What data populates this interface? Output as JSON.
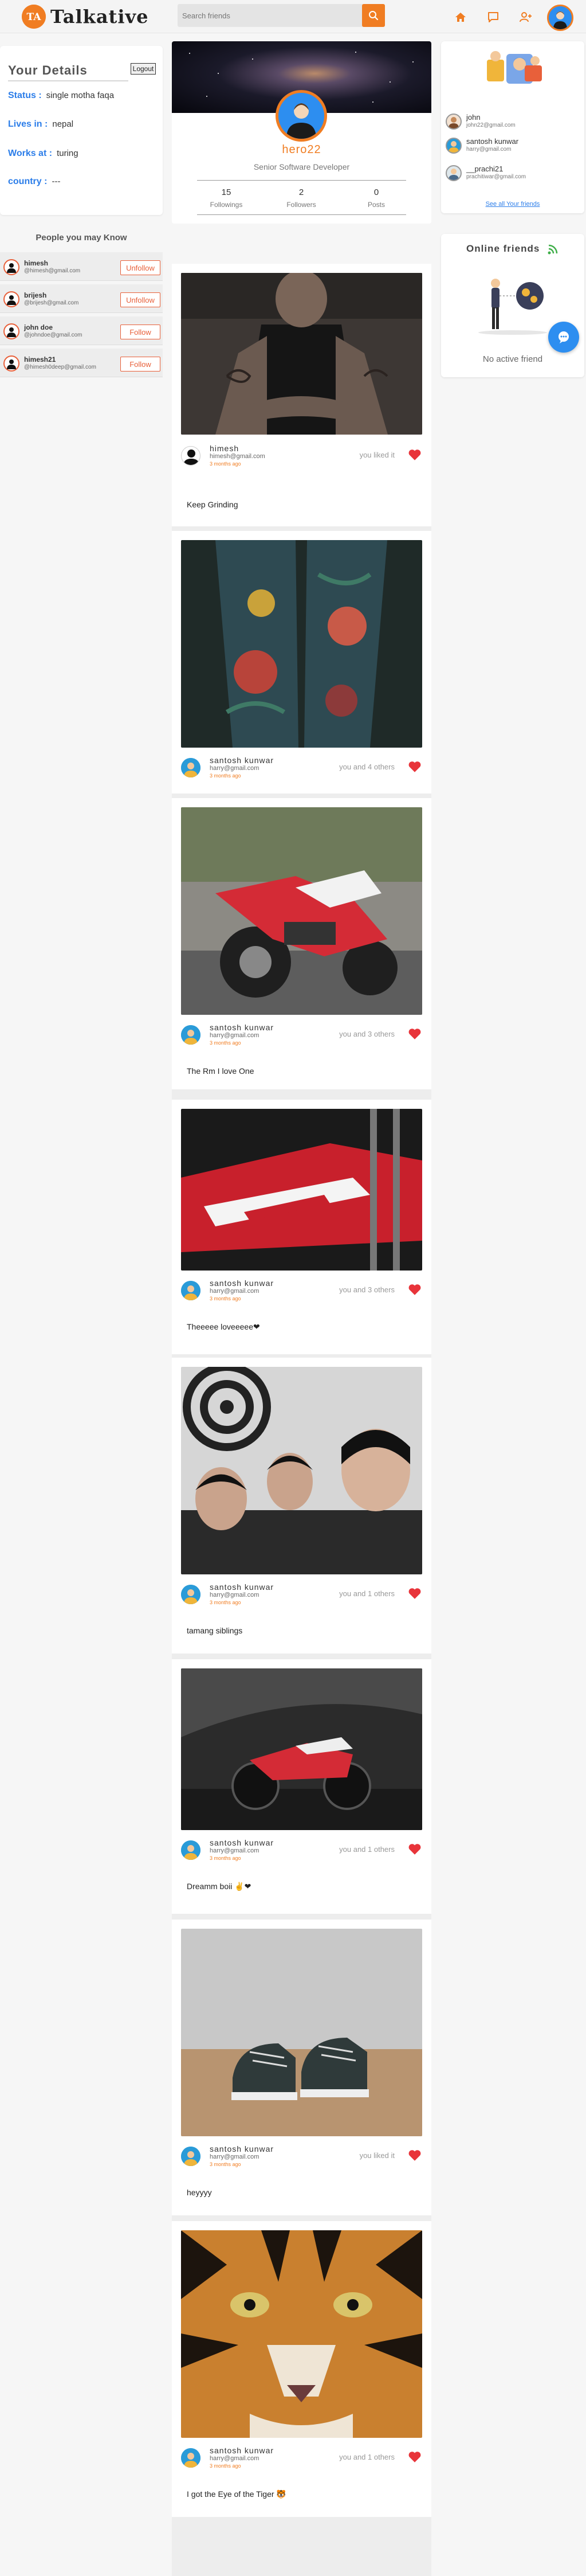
{
  "brand": {
    "logo_letter": "TA",
    "name": "Talkative"
  },
  "search": {
    "placeholder": "Search friends",
    "value": ""
  },
  "details": {
    "title": "Your Details",
    "logout_label": "Logout",
    "status_key": "Status :",
    "status_val": "single motha faqa",
    "lives_key": "Lives in :",
    "lives_val": "nepal",
    "works_key": "Works at :",
    "works_val": "turing",
    "country_key": "country :",
    "country_val": "---"
  },
  "people": {
    "title": "People you may Know",
    "items": [
      {
        "name": "himesh",
        "email": "@himesh@gmail.com",
        "action": "Unfollow"
      },
      {
        "name": "brijesh",
        "email": "@brijesh@gmail.com",
        "action": "Unfollow"
      },
      {
        "name": "john doe",
        "email": "@johndoe@gmail.com",
        "action": "Follow"
      },
      {
        "name": "himesh21",
        "email": "@himesh0deep@gmail.com",
        "action": "Follow"
      }
    ]
  },
  "profile": {
    "name": "hero22",
    "role": "Senior Software Developer",
    "followings": "15",
    "followings_label": "Followings",
    "followers": "2",
    "followers_label": "Followers",
    "posts": "0",
    "posts_label": "Posts"
  },
  "posts": [
    {
      "user": "himesh",
      "email": "himesh@gmail.com",
      "time": "3 months ago",
      "likes": "you liked it",
      "caption": "Keep Grinding"
    },
    {
      "user": "santosh kunwar",
      "email": "harry@gmail.com",
      "time": "3 months ago",
      "likes": "you and 4 others",
      "caption": ""
    },
    {
      "user": "santosh kunwar",
      "email": "harry@gmail.com",
      "time": "3 months ago",
      "likes": "you and 3 others",
      "caption": "The Rm I love One"
    },
    {
      "user": "santosh kunwar",
      "email": "harry@gmail.com",
      "time": "3 months ago",
      "likes": "you and 3 others",
      "caption": "Theeeee loveeeee❤"
    },
    {
      "user": "santosh kunwar",
      "email": "harry@gmail.com",
      "time": "3 months ago",
      "likes": "you and 1 others",
      "caption": "tamang siblings"
    },
    {
      "user": "santosh kunwar",
      "email": "harry@gmail.com",
      "time": "3 months ago",
      "likes": "you and 1 others",
      "caption": "Dreamm boii ✌❤"
    },
    {
      "user": "santosh kunwar",
      "email": "harry@gmail.com",
      "time": "3 months ago",
      "likes": "you liked it",
      "caption": "heyyyy"
    },
    {
      "user": "santosh kunwar",
      "email": "harry@gmail.com",
      "time": "3 months ago",
      "likes": "you and 1 others",
      "caption": "I got the Eye of the Tiger 🐯"
    }
  ],
  "friends": {
    "items": [
      {
        "name": "john",
        "email": "john22@gmail.com"
      },
      {
        "name": "santosh kunwar",
        "email": "harry@gmail.com"
      },
      {
        "name": "__prachi21",
        "email": "prachitiwar@gmail.com"
      }
    ],
    "see_all": "See all Your friends"
  },
  "online": {
    "title": "Online friends",
    "empty": "No active friend"
  },
  "colors": {
    "accent": "#f07d22",
    "link": "#2b7de9",
    "heart": "#e8343a",
    "avatar_bg": "#2d8ef0"
  },
  "icons": [
    "search-icon",
    "home-icon",
    "chat-icon",
    "add-user-icon",
    "heart-icon",
    "rss-icon",
    "chat-bubble-icon"
  ]
}
